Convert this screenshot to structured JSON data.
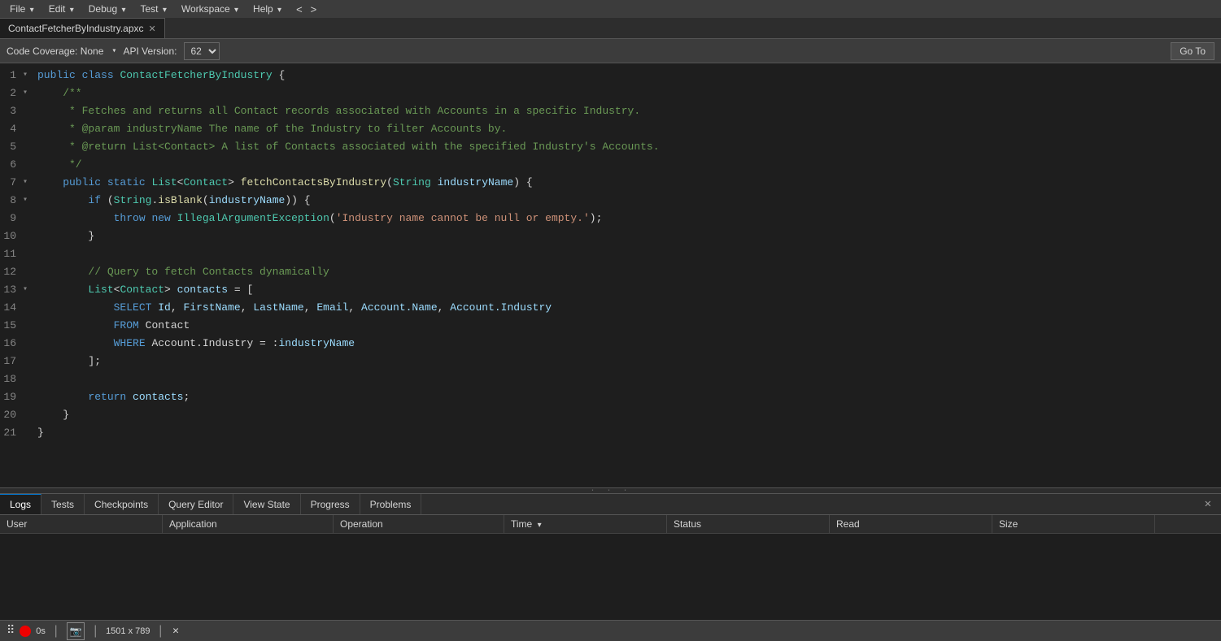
{
  "menubar": {
    "items": [
      {
        "label": "File",
        "has_arrow": true
      },
      {
        "label": "Edit",
        "has_arrow": true
      },
      {
        "label": "Debug",
        "has_arrow": true
      },
      {
        "label": "Test",
        "has_arrow": true
      },
      {
        "label": "Workspace",
        "has_arrow": true
      },
      {
        "label": "Help",
        "has_arrow": true
      }
    ],
    "nav_back": "<",
    "nav_fwd": ">"
  },
  "tab": {
    "label": "ContactFetcherByIndustry.apxc",
    "close": "✕"
  },
  "toolbar": {
    "coverage_label": "Code Coverage: None",
    "api_label": "API Version:",
    "api_value": "62",
    "goto_label": "Go To"
  },
  "code_lines": [
    {
      "num": 1,
      "fold": "▾",
      "html_id": "l1"
    },
    {
      "num": 2,
      "fold": "▾",
      "html_id": "l2"
    },
    {
      "num": 3,
      "fold": "",
      "html_id": "l3"
    },
    {
      "num": 4,
      "fold": "",
      "html_id": "l4"
    },
    {
      "num": 5,
      "fold": "",
      "html_id": "l5"
    },
    {
      "num": 6,
      "fold": "",
      "html_id": "l6"
    },
    {
      "num": 7,
      "fold": "▾",
      "html_id": "l7"
    },
    {
      "num": 8,
      "fold": "▾",
      "html_id": "l8"
    },
    {
      "num": 9,
      "fold": "",
      "html_id": "l9"
    },
    {
      "num": 10,
      "fold": "",
      "html_id": "l10"
    },
    {
      "num": 11,
      "fold": "",
      "html_id": "l11"
    },
    {
      "num": 12,
      "fold": "",
      "html_id": "l12"
    },
    {
      "num": 13,
      "fold": "▾",
      "html_id": "l13"
    },
    {
      "num": 14,
      "fold": "",
      "html_id": "l14"
    },
    {
      "num": 15,
      "fold": "",
      "html_id": "l15"
    },
    {
      "num": 16,
      "fold": "",
      "html_id": "l16"
    },
    {
      "num": 17,
      "fold": "",
      "html_id": "l17"
    },
    {
      "num": 18,
      "fold": "",
      "html_id": "l18"
    },
    {
      "num": 19,
      "fold": "",
      "html_id": "l19"
    },
    {
      "num": 20,
      "fold": "",
      "html_id": "l20"
    },
    {
      "num": 21,
      "fold": "",
      "html_id": "l21"
    }
  ],
  "bottom_panel": {
    "tabs": [
      {
        "label": "Logs",
        "active": true
      },
      {
        "label": "Tests",
        "active": false
      },
      {
        "label": "Checkpoints",
        "active": false
      },
      {
        "label": "Query Editor",
        "active": false
      },
      {
        "label": "View State",
        "active": false
      },
      {
        "label": "Progress",
        "active": false
      },
      {
        "label": "Problems",
        "active": false
      }
    ],
    "table_headers": [
      {
        "label": "User",
        "sort": false
      },
      {
        "label": "Application",
        "sort": false
      },
      {
        "label": "Operation",
        "sort": false
      },
      {
        "label": "Time",
        "sort": true,
        "sort_dir": "▾"
      },
      {
        "label": "Status",
        "sort": false
      },
      {
        "label": "Read",
        "sort": false
      },
      {
        "label": "Size",
        "sort": false
      }
    ]
  },
  "status_bar": {
    "dimensions": "1501 x 789"
  },
  "bottom_toolbar": {
    "time_label": "0s",
    "close_label": "✕"
  }
}
